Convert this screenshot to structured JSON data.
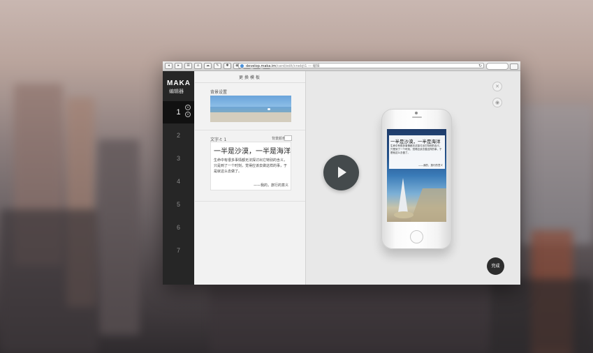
{
  "browser": {
    "url_host": "develop.maka.im",
    "url_path": "/card/edit/cnebjt1 — 编辑",
    "nav_buttons": [
      "◂",
      "▸",
      "⊞",
      "⌂",
      "☁",
      "✎",
      "✱",
      "◉",
      "⊙",
      "☐",
      "⊕"
    ]
  },
  "sidebar": {
    "logo": "MAKA",
    "logo_sub": "编辑器",
    "pages": [
      "1",
      "2",
      "3",
      "4",
      "5",
      "6",
      "7"
    ],
    "active_page": "1",
    "up_arrow": "∧",
    "down_arrow": "∨"
  },
  "editor": {
    "title": "更换模板",
    "background_label": "背景设置",
    "text_label": "文字-t_1",
    "bgcolor_label": "背景颜色",
    "headline": "一半是沙漠，一半是海洋",
    "body": "生命中有很多事情都无法探讨出它特别的含义，只是到了一个时刻，觉得应该去做这样的事，于是就这么去做了。",
    "signature": "——我的，旅行的意义"
  },
  "preview": {
    "close_icon": "✕",
    "eye_icon": "◉",
    "done_label": "完成",
    "screen_headline": "一半是沙漠，一半是海洋",
    "screen_body": "生命中有很多事情都无法探讨出它特别的含义，只是到了一个时刻，觉得应该去做这样的事，于是就这么去做了。",
    "screen_signature": "——我的，旅行的意义"
  }
}
